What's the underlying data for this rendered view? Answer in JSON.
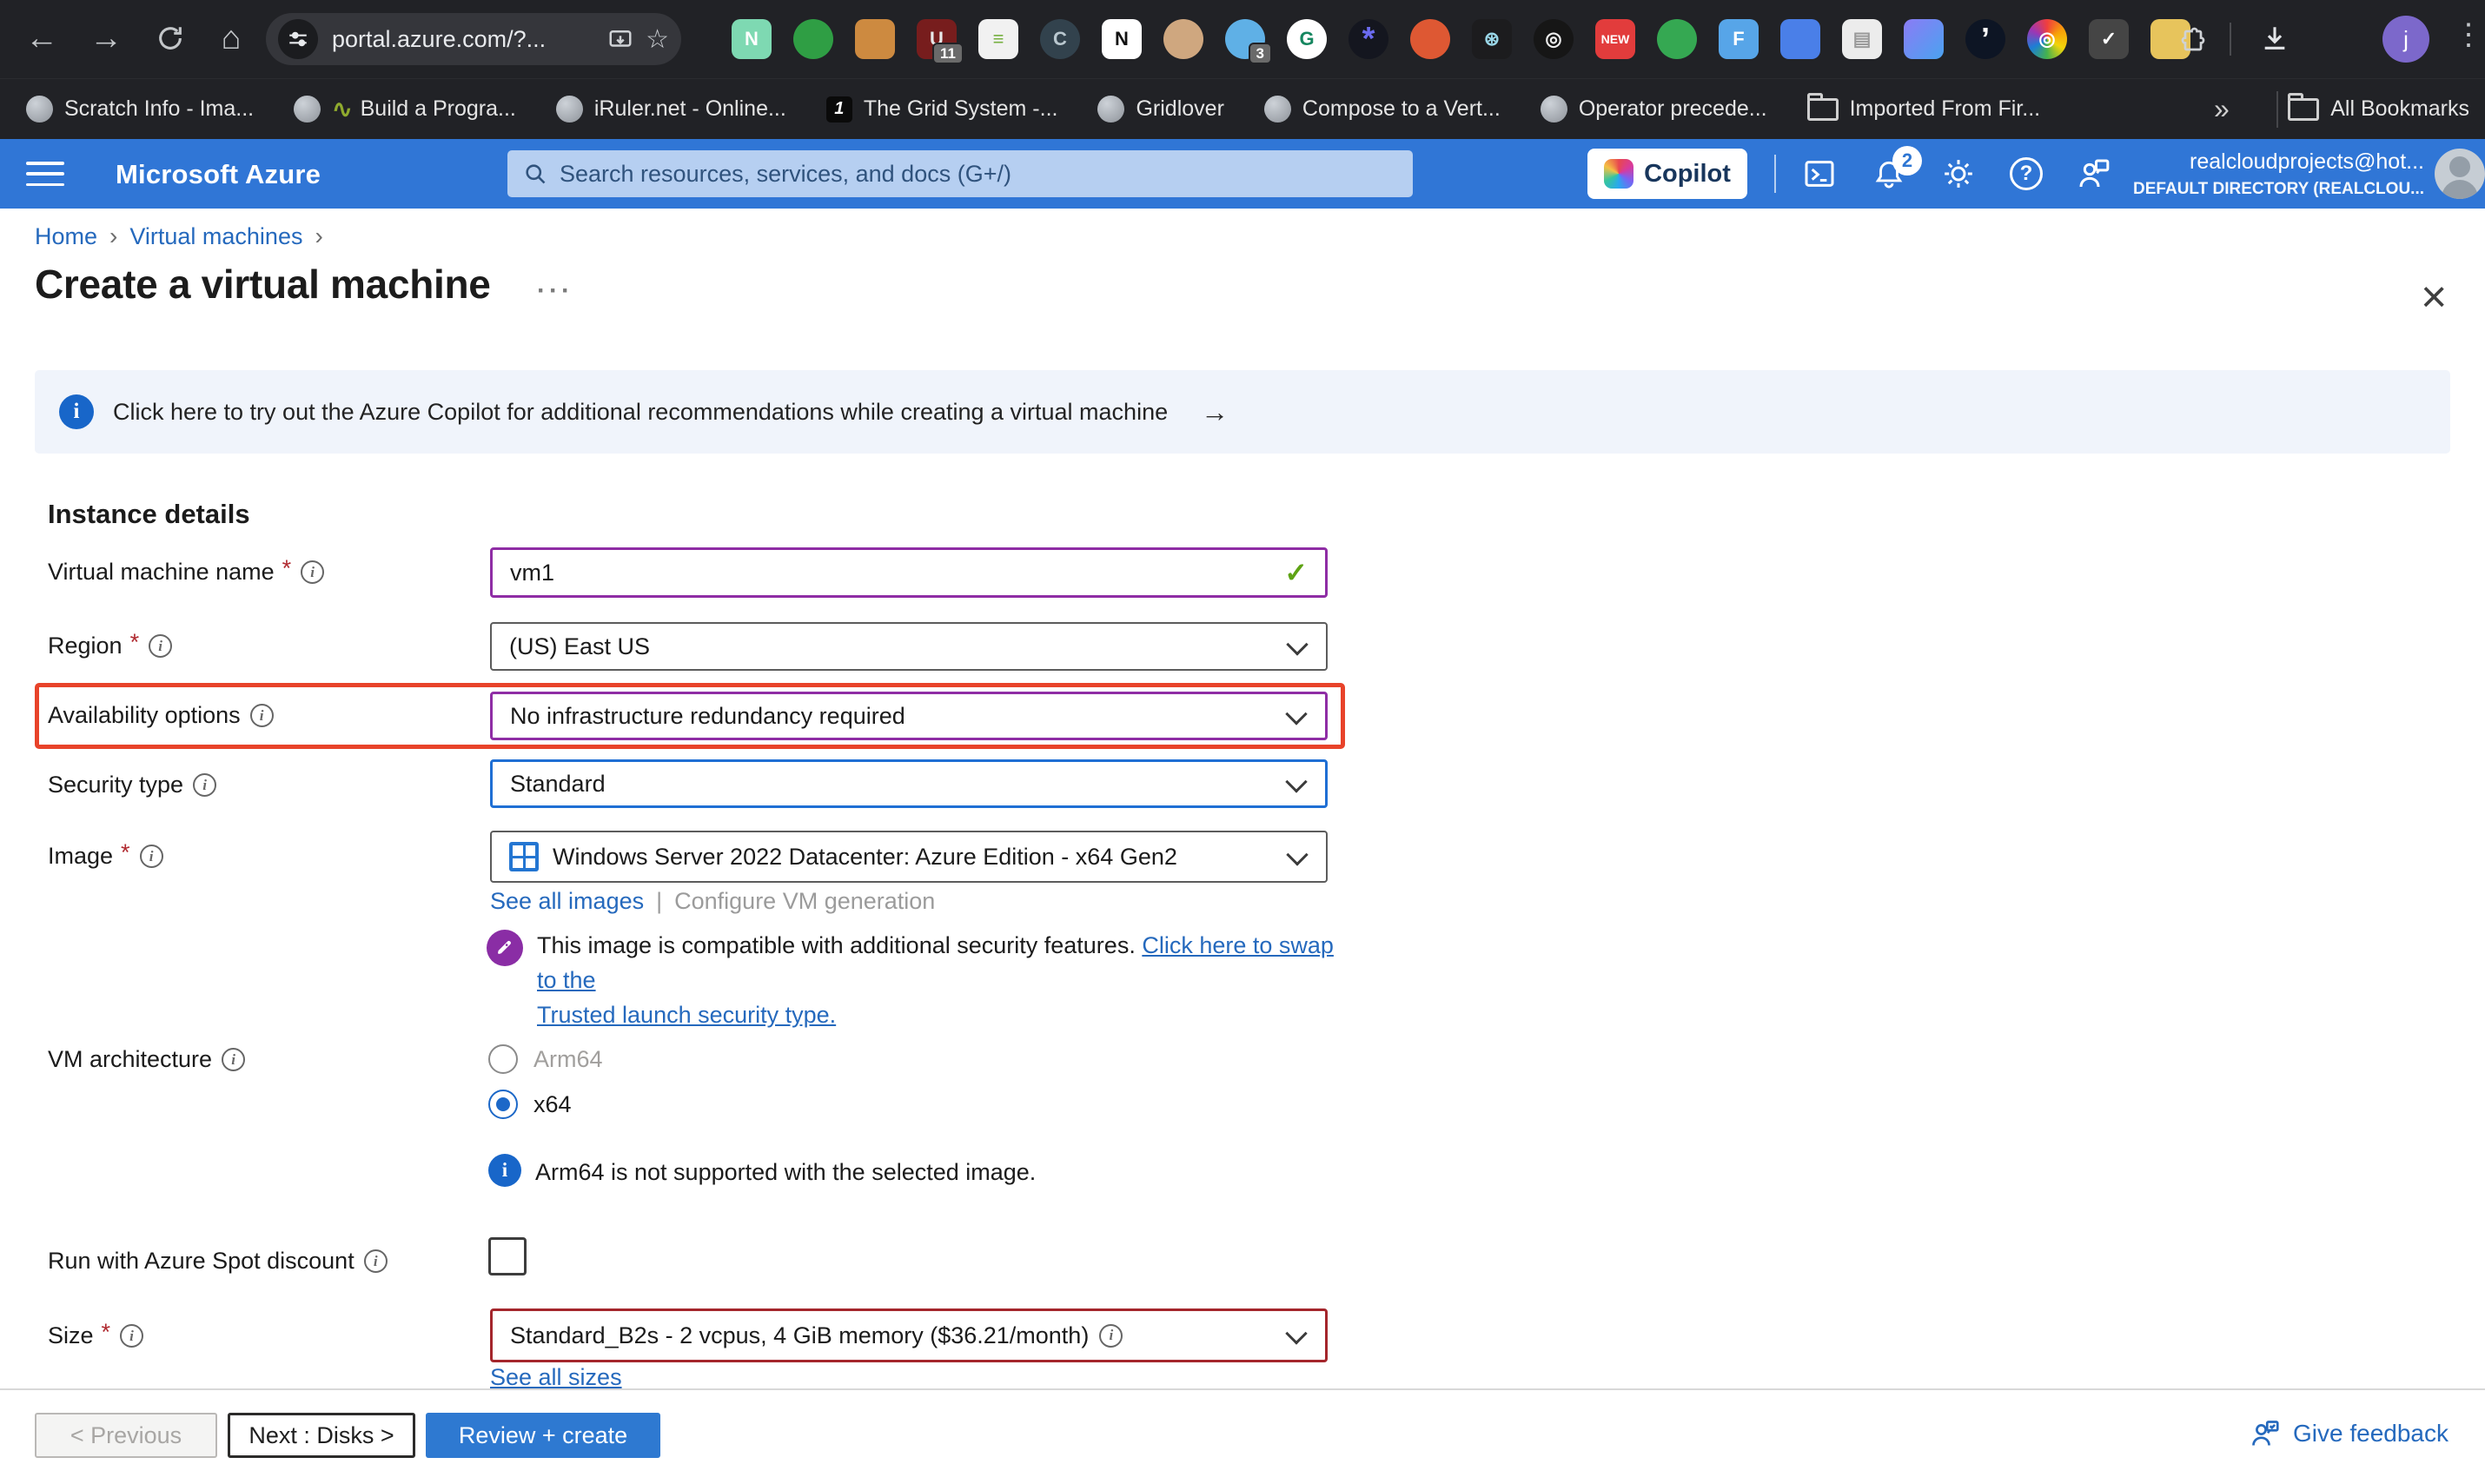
{
  "browser": {
    "url": "portal.azure.com/?...",
    "profile_initial": "j",
    "all_bookmarks_label": "All Bookmarks",
    "bookmarks": [
      {
        "label": "Scratch Info - Ima...",
        "icon": "globe"
      },
      {
        "label": "Build a Progra...",
        "icon": "globe-snake"
      },
      {
        "label": "iRuler.net - Online...",
        "icon": "globe"
      },
      {
        "label": "The Grid System -...",
        "icon": "one-favicon",
        "favicon_text": "1"
      },
      {
        "label": "Gridlover",
        "icon": "globe"
      },
      {
        "label": "Compose to a Vert...",
        "icon": "globe"
      },
      {
        "label": "Operator precede...",
        "icon": "globe"
      },
      {
        "label": "Imported From Fir...",
        "icon": "folder"
      }
    ],
    "extensions": [
      {
        "name": "notes-n",
        "color": "#7ed9b2",
        "glyph": "N",
        "fg": "#ffffff",
        "shape": "rounded"
      },
      {
        "name": "evernote-elephant",
        "color": "#2f9e44",
        "glyph": "",
        "fg": "#ffffff",
        "shape": "round"
      },
      {
        "name": "camel-book",
        "color": "#cd8a40",
        "glyph": "",
        "fg": "#ffffff",
        "shape": "rounded"
      },
      {
        "name": "ublock-shield",
        "color": "#771d1d",
        "glyph": "U",
        "fg": "#e8e8e8",
        "shape": "rounded",
        "badge": "11"
      },
      {
        "name": "list-document",
        "color": "#f1f1f1",
        "glyph": "≡",
        "fg": "#76b041",
        "shape": "rounded"
      },
      {
        "name": "crescent-c",
        "color": "#32424d",
        "glyph": "C",
        "fg": "#b9c7cf",
        "shape": "round"
      },
      {
        "name": "notion-n",
        "color": "#ffffff",
        "glyph": "N",
        "fg": "#111111",
        "shape": "rounded"
      },
      {
        "name": "avatar-face",
        "color": "#cfa77f",
        "glyph": "",
        "fg": "#ffffff",
        "shape": "round"
      },
      {
        "name": "ghost",
        "color": "#5fb0e6",
        "glyph": "",
        "fg": "#ffffff",
        "shape": "round",
        "badge": "3"
      },
      {
        "name": "grammarly-g",
        "color": "#ffffff",
        "glyph": "G",
        "fg": "#15865f",
        "shape": "round"
      },
      {
        "name": "asterisk-flower",
        "color": "#14161f",
        "glyph": "*",
        "fg": "#6b6bf0",
        "shape": "round",
        "fs": 38
      },
      {
        "name": "duckduckgo",
        "color": "#de5833",
        "glyph": "",
        "fg": "#ffffff",
        "shape": "round"
      },
      {
        "name": "react-atom",
        "color": "#1c1c1e",
        "glyph": "⊛",
        "fg": "#9ad7e8",
        "shape": "rounded"
      },
      {
        "name": "target-rings",
        "color": "#161616",
        "glyph": "◎",
        "fg": "#eeeeee",
        "shape": "round"
      },
      {
        "name": "new-badge",
        "color": "#e23c3c",
        "glyph": "NEW",
        "fg": "#ffffff",
        "shape": "rounded",
        "fs": 14
      },
      {
        "name": "green-dancer",
        "color": "#35a852",
        "glyph": "",
        "fg": "#ffffff",
        "shape": "round"
      },
      {
        "name": "fonts-f",
        "color": "#57a5e8",
        "glyph": "F",
        "fg": "#ffffff",
        "shape": "rounded"
      },
      {
        "name": "phone",
        "color": "#4a7fe8",
        "glyph": "",
        "fg": "#ffffff",
        "shape": "rounded"
      },
      {
        "name": "document",
        "color": "#ececec",
        "glyph": "▤",
        "fg": "#9a9a9a",
        "shape": "rounded"
      },
      {
        "name": "gradient-grid",
        "color": "linear-gradient(135deg,#8b7bf5,#4aa3f0)",
        "glyph": "",
        "fg": "#ffffff",
        "shape": "rounded"
      },
      {
        "name": "quote-mark",
        "color": "#0d1524",
        "glyph": "’",
        "fg": "#ffffff",
        "shape": "round",
        "fs": 36
      },
      {
        "name": "rainbow-lens",
        "color": "conic-gradient(#f03e3e,#f7a008,#f2d50b,#46b24d,#1c7ed6,#9c36b5,#f03e3e)",
        "glyph": "◎",
        "fg": "#ffffff",
        "shape": "round"
      },
      {
        "name": "check-dark",
        "color": "#454545",
        "glyph": "✓",
        "fg": "#ffffff",
        "shape": "rounded"
      },
      {
        "name": "folder-yellow",
        "color": "#e7c45c",
        "glyph": "",
        "fg": "#ffffff",
        "shape": "rounded"
      }
    ]
  },
  "azure": {
    "brand": "Microsoft Azure",
    "search_placeholder": "Search resources, services, and docs (G+/)",
    "copilot_label": "Copilot",
    "notification_count": "2",
    "account_email": "realcloudprojects@hot...",
    "account_directory": "DEFAULT DIRECTORY (REALCLOU..."
  },
  "page": {
    "breadcrumbs": [
      "Home",
      "Virtual machines"
    ],
    "title": "Create a virtual machine",
    "banner_text": "Click here to try out the Azure Copilot for additional recommendations while creating a virtual machine",
    "banner_arrow": "→"
  },
  "form": {
    "required_marker": "*",
    "section_heading": "Instance details",
    "vm_name": {
      "label": "Virtual machine name",
      "value": "vm1"
    },
    "region": {
      "label": "Region",
      "value": "(US) East US"
    },
    "availability": {
      "label": "Availability options",
      "value": "No infrastructure redundancy required"
    },
    "security": {
      "label": "Security type",
      "value": "Standard"
    },
    "image": {
      "label": "Image",
      "value": "Windows Server 2022 Datacenter: Azure Edition - x64 Gen2",
      "see_all_link": "See all images",
      "link_sep": "|",
      "configure_link": "Configure VM generation",
      "note_text": "This image is compatible with additional security features. ",
      "note_link_1": "Click here to swap to the",
      "note_link_2": "Trusted launch security type."
    },
    "vm_architecture": {
      "label": "VM architecture",
      "option_arm64": "Arm64",
      "option_x64": "x64",
      "selected": "x64",
      "note": "Arm64 is not supported with the selected image."
    },
    "spot": {
      "label": "Run with Azure Spot discount",
      "checked": false
    },
    "size": {
      "label": "Size",
      "value": "Standard_B2s - 2 vcpus, 4 GiB memory ($36.21/month)",
      "see_all_link": "See all sizes"
    }
  },
  "footer": {
    "previous": "< Previous",
    "next": "Next : Disks >",
    "review_create": "Review + create",
    "give_feedback": "Give feedback"
  }
}
